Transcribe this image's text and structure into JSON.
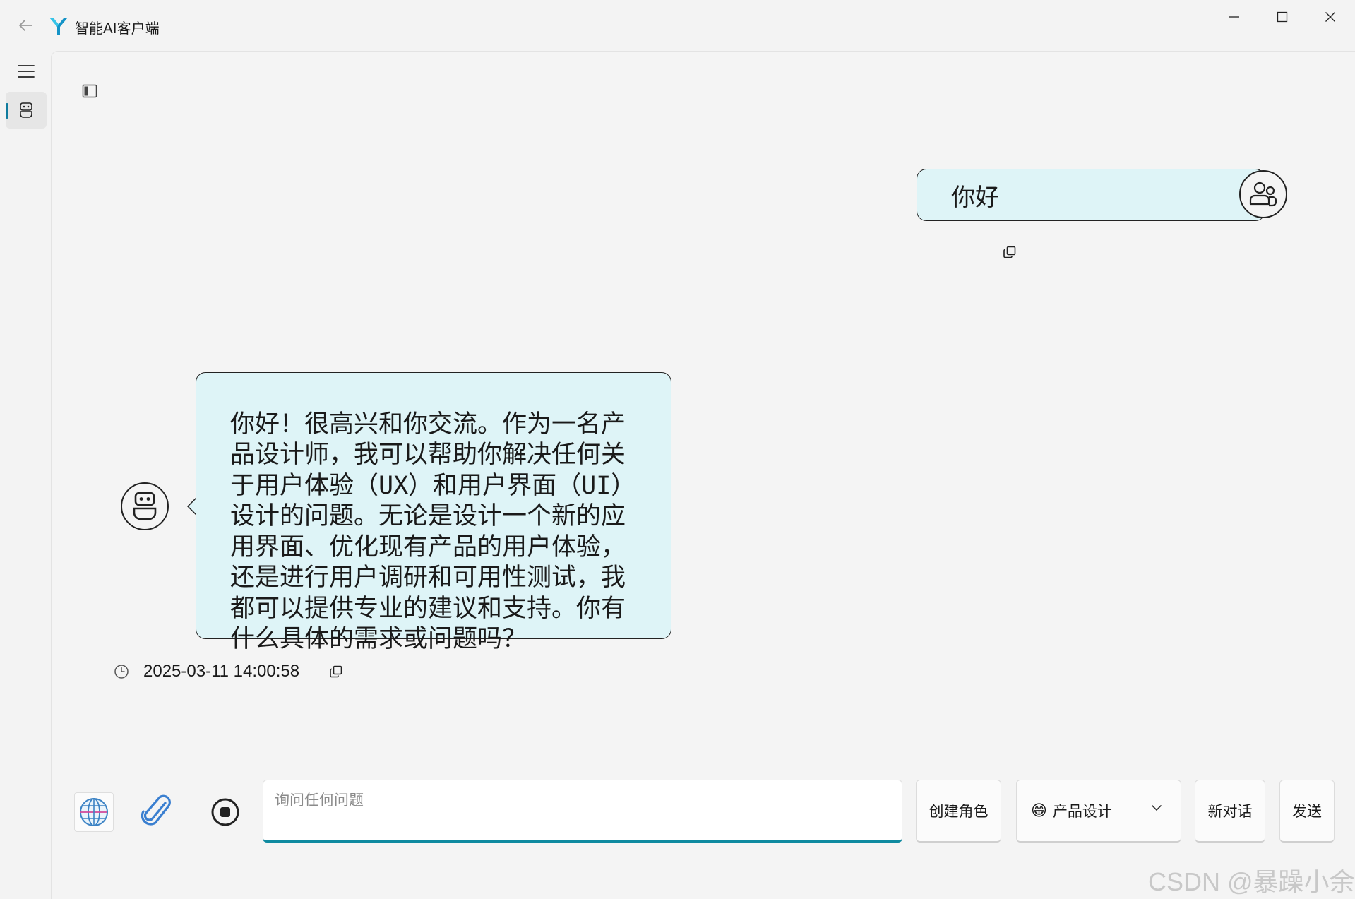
{
  "window": {
    "title": "智能AI客户端"
  },
  "conversation": {
    "user_message": "你好",
    "bot_message": "你好！很高兴和你交流。作为一名产\n品设计师，我可以帮助你解决任何关\n于用户体验（UX）和用户界面（UI）\n设计的问题。无论是设计一个新的应\n用界面、优化现有产品的用户体验，\n还是进行用户调研和可用性测试，我\n都可以提供专业的建议和支持。你有\n什么具体的需求或问题吗？",
    "bot_timestamp": "2025-03-11 14:00:58"
  },
  "composer": {
    "placeholder": "询问任何问题",
    "value": ""
  },
  "actions": {
    "create_role": "创建角色",
    "role_select": {
      "emoji": "😁",
      "selected": "产品设计"
    },
    "new_chat": "新对话",
    "send": "发送"
  },
  "watermark": "CSDN @暴躁小余",
  "colors": {
    "bubble_bg": "#def4f7",
    "accent": "#0f8aa0",
    "rail_indicator": "#0f7b9e"
  },
  "icons": {
    "back": "arrow-left-icon",
    "logo": "app-logo-icon",
    "minimize": "minimize-icon",
    "maximize": "maximize-icon",
    "close": "close-icon",
    "menu": "hamburger-icon",
    "robot": "robot-icon",
    "user": "users-icon",
    "copy": "copy-icon",
    "clock": "clock-icon",
    "globe": "globe-icon",
    "attach": "paperclip-icon",
    "stop": "stop-icon",
    "chevron": "chevron-down-icon"
  }
}
